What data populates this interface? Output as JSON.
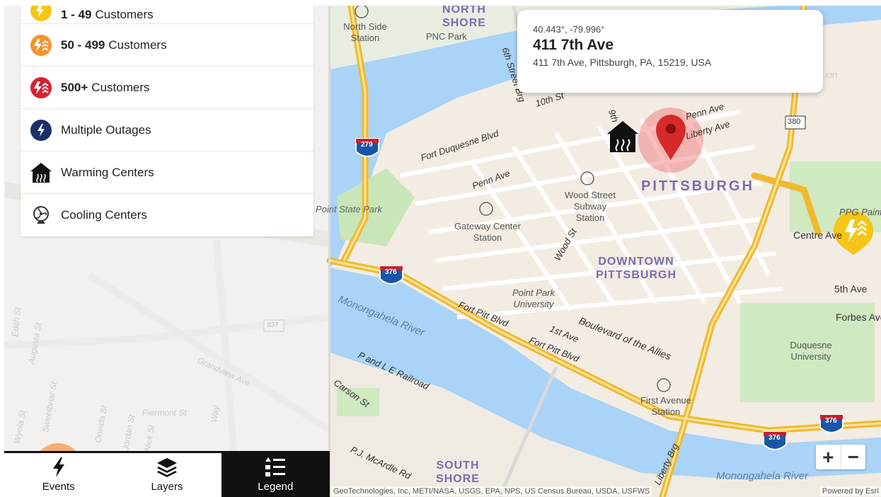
{
  "legend": {
    "items": [
      {
        "bold": "1 - 49",
        "label": "Customers",
        "icon": "outage-yellow-icon",
        "color": "#f5c518"
      },
      {
        "bold": "50 - 499",
        "label": "Customers",
        "icon": "outage-orange-icon",
        "color": "#f5922a"
      },
      {
        "bold": "500+",
        "label": "Customers",
        "icon": "outage-red-icon",
        "color": "#d42330"
      },
      {
        "bold": "",
        "label": "Multiple Outages",
        "icon": "multiple-outages-icon",
        "color": "#1b2f6b"
      },
      {
        "bold": "",
        "label": "Warming Centers",
        "icon": "warming-center-icon",
        "color": "#111111"
      },
      {
        "bold": "",
        "label": "Cooling Centers",
        "icon": "cooling-center-icon",
        "color": "#333333"
      }
    ]
  },
  "popup": {
    "coords": "40.443°, -79.996°",
    "title": "411 7th Ave",
    "address": "411 7th Ave, Pittsburgh, PA, 15219, USA"
  },
  "tabs": [
    {
      "label": "Events",
      "icon": "lightning-icon"
    },
    {
      "label": "Layers",
      "icon": "layers-icon"
    },
    {
      "label": "Legend",
      "icon": "legend-list-icon"
    }
  ],
  "zoom": {
    "in": "+",
    "out": "−"
  },
  "map": {
    "labels": {
      "north_shore": "NORTH SHORE",
      "pnc_park": "PNC Park",
      "north_side_station": "North Side Station",
      "sixth_street_brg": "6th Street Brg",
      "tenth_st": "10th St",
      "fort_duquesne": "Fort Duquesne Blvd",
      "penn_ave": "Penn Ave",
      "liberty_ave": "Liberty Ave",
      "ninth": "9th",
      "penn_ave_2": "Penn Ave",
      "wood_street_station": "Wood Street Subway Station",
      "pittsburgh": "PITTSBURGH",
      "gateway_center": "Gateway Center Station",
      "point_state_park": "Point State Park",
      "wood_st": "Wood St",
      "downtown": "DOWNTOWN PITTSBURGH",
      "point_park": "Point Park University",
      "fort_pitt_blvd": "Fort Pitt Blvd",
      "fort_pitt_blvd_2": "Fort Pitt Blvd",
      "first_ave": "1st Ave",
      "blvd_allies": "Boulevard of the Allies",
      "monongahela": "Monongahela River",
      "monongahela_2": "Monongahela River",
      "p_le_railroad": "P and L E Railroad",
      "carson": "Carson St",
      "first_avenue_station": "First Avenue Station",
      "liberty_brg": "Liberty Brg",
      "south_shore": "SOUTH SHORE",
      "pj_mcardle": "P.J. McArdle Rd",
      "fifth_ave": "5th Ave",
      "forbes": "Forbes Ave",
      "duquesne_univ": "Duquesne University",
      "ppg_paints": "PPG Paints",
      "centre_ave": "Centre Ave",
      "grandview": "Grandview Ave",
      "piermont": "Piermont St",
      "edith": "Edith St",
      "augusta": "Augusta St",
      "sweetbriar": "Sweetbriar St",
      "wyola": "Wyola St",
      "oneida": "Oneida St",
      "jordan": "Jordan St",
      "nick": "Nick St",
      "way": "Way",
      "i279": "279",
      "i376a": "376",
      "i376b": "376",
      "i376c": "376",
      "us380": "380",
      "us837": "837",
      "ion": "ion"
    }
  },
  "attribution": "GeoTechnologies, Inc, METI/NASA, USGS, EPA, NPS, US Census Bureau, USDA, USFWS",
  "powered_by": "Powered by Esri"
}
